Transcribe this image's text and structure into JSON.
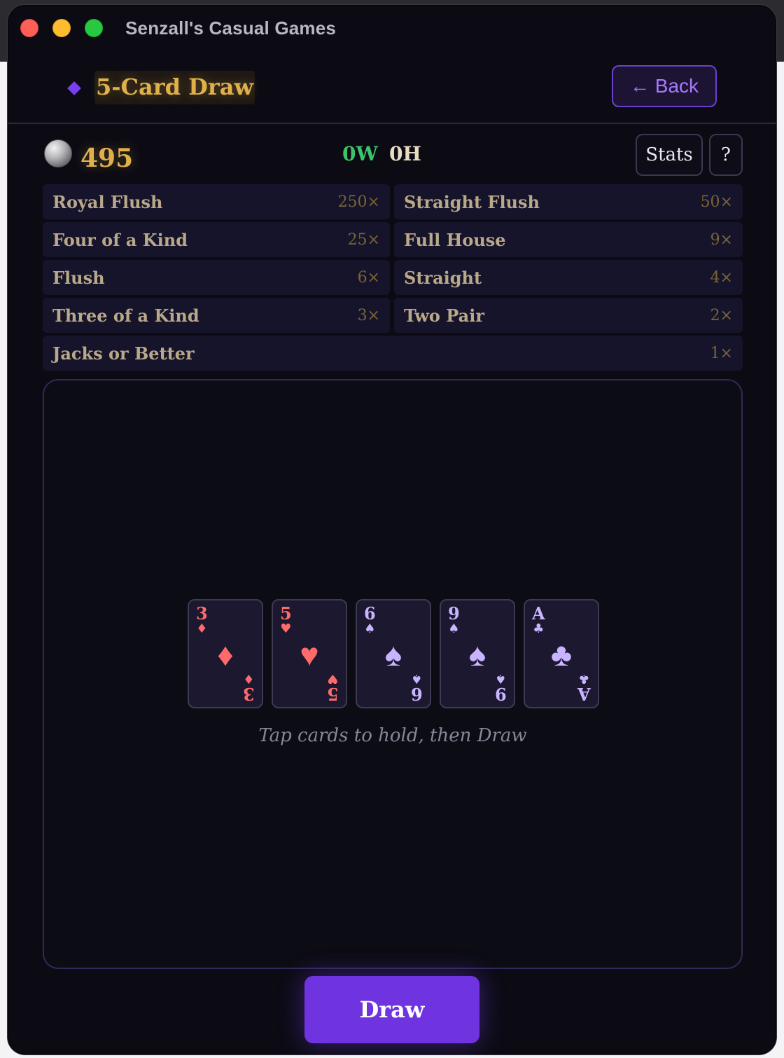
{
  "window": {
    "title": "Senzall's Casual Games"
  },
  "header": {
    "game_title": "5-Card Draw",
    "back_label": "← Back"
  },
  "status": {
    "balance": "495",
    "wins": "0W",
    "hands": "0H",
    "stats_label": "Stats",
    "help_label": "?"
  },
  "paytable": [
    {
      "name": "Royal Flush",
      "mult": "250×"
    },
    {
      "name": "Straight Flush",
      "mult": "50×"
    },
    {
      "name": "Four of a Kind",
      "mult": "25×"
    },
    {
      "name": "Full House",
      "mult": "9×"
    },
    {
      "name": "Flush",
      "mult": "6×"
    },
    {
      "name": "Straight",
      "mult": "4×"
    },
    {
      "name": "Three of a Kind",
      "mult": "3×"
    },
    {
      "name": "Two Pair",
      "mult": "2×"
    },
    {
      "name": "Jacks or Better",
      "mult": "1×"
    }
  ],
  "hand": [
    {
      "rank": "3",
      "suit": "♦",
      "suit_name": "diamonds",
      "color": "#ff6b6b"
    },
    {
      "rank": "5",
      "suit": "♥",
      "suit_name": "hearts",
      "color": "#ff6b6b"
    },
    {
      "rank": "6",
      "suit": "♠",
      "suit_name": "spades",
      "color": "#c9b5ff"
    },
    {
      "rank": "9",
      "suit": "♠",
      "suit_name": "spades",
      "color": "#c9b5ff"
    },
    {
      "rank": "A",
      "suit": "♣",
      "suit_name": "clubs",
      "color": "#c9b5ff"
    }
  ],
  "hint": "Tap cards to hold, then Draw",
  "draw_label": "Draw",
  "colors": {
    "accent": "#6f34e0",
    "gold": "#e0b14a",
    "win_green": "#3cc46a",
    "background": "#0c0b14"
  }
}
